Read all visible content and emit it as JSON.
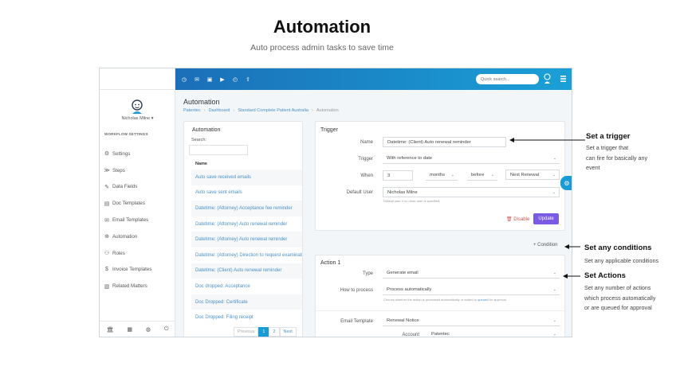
{
  "hero": {
    "title": "Automation",
    "subtitle": "Auto process admin tasks to save time"
  },
  "topbar": {
    "icons": [
      "clock-icon",
      "mail-icon",
      "card-icon",
      "play-icon",
      "history-icon",
      "upload-icon"
    ],
    "search_placeholder": "Quick search...",
    "accent_color": "#1a9bd6"
  },
  "sidebar": {
    "user_name": "Nicholas Milne",
    "section_label": "WORKFLOW SETTINGS",
    "items": [
      {
        "icon": "⚙",
        "label": "Settings"
      },
      {
        "icon": "≫",
        "label": "Steps"
      },
      {
        "icon": "✎",
        "label": "Data Fields"
      },
      {
        "icon": "▤",
        "label": "Doc Templates"
      },
      {
        "icon": "✉",
        "label": "Email Templates"
      },
      {
        "icon": "⊕",
        "label": "Automation"
      },
      {
        "icon": "⚇",
        "label": "Roles"
      },
      {
        "icon": "$",
        "label": "Invoice Templates"
      },
      {
        "icon": "▥",
        "label": "Related Matters"
      }
    ]
  },
  "page": {
    "title": "Automation",
    "breadcrumbs": [
      "Patentec",
      "Dashboard",
      "Standard Complete Patient Australia",
      "Automation"
    ]
  },
  "list": {
    "title": "Automation",
    "search_label": "Search:",
    "column": "Name",
    "rows": [
      "Auto save received emails",
      "Auto save sent emails",
      "Datetime: (Attorney) Acceptance fee reminder",
      "Datetime: (Attorney) Auto renewal reminder",
      "Datetime: (Attorney) Auto renewal reminder",
      "Datetime: (Attorney) Direction to request examination",
      "Datetime: (Client) Auto renewal reminder",
      "Doc dropped: Acceptance",
      "Doc Dropped: Certificate",
      "Doc Dropped: Filing receipt"
    ],
    "pager": {
      "previous": "Previous",
      "page1": "1",
      "page2": "2",
      "next": "Next"
    }
  },
  "trigger": {
    "title": "Trigger",
    "name_label": "Name",
    "name_value": "Datetime: (Client) Auto renewal reminder",
    "trigger_label": "Trigger",
    "trigger_value": "With reference to date",
    "when_label": "When",
    "when_number": "3",
    "when_unit": "months",
    "when_relation": "before",
    "when_event": "Next Renewal",
    "default_user_label": "Default User",
    "default_user_value": "Nicholas Milne",
    "default_user_hint": "Default user if no other user is specified.",
    "disable_label": "Disable",
    "update_label": "Update"
  },
  "condition": {
    "add_label": "+ Condition"
  },
  "action": {
    "title": "Action 1",
    "type_label": "Type",
    "type_value": "Generate email",
    "process_label": "How to process",
    "process_value": "Process automatically",
    "process_hint_pre": "Choose whether the action is processed automatically or added to ",
    "process_hint_link": "queued",
    "process_hint_post": " for approval.",
    "email_template_label": "Email Template",
    "email_template_value": "Renewal Notice",
    "account_label": "Account",
    "account_value": "Patentec"
  },
  "annotations": {
    "trigger": {
      "title": "Set a trigger",
      "lines": [
        "Set a trigger that",
        "can fire for basically any",
        "event"
      ]
    },
    "conditions": {
      "title": "Set any conditions",
      "lines": [
        "Set any applicable conditions"
      ]
    },
    "actions": {
      "title": "Set Actions",
      "lines": [
        "Set any number of actions",
        "which process automatically",
        "or are queued for approval"
      ]
    }
  }
}
